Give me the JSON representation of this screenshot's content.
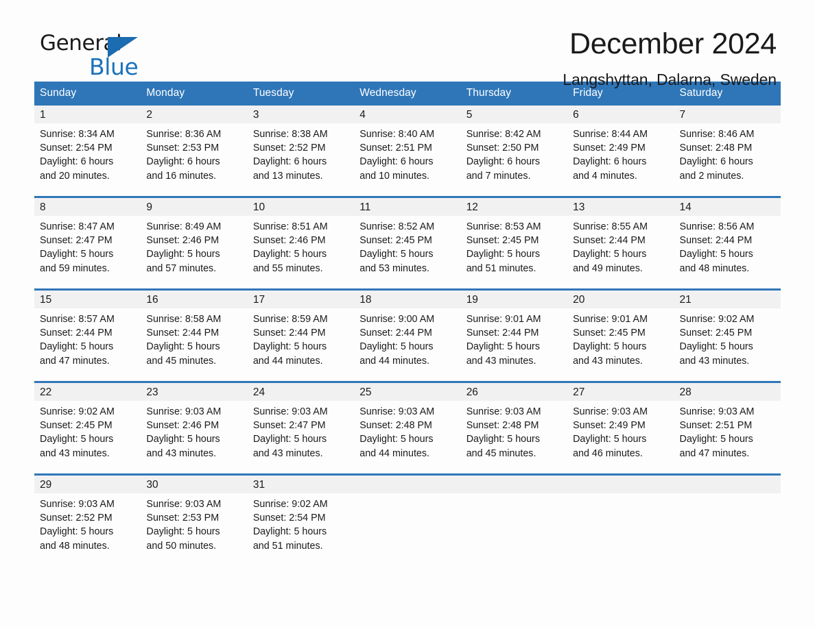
{
  "brand": {
    "name_part1": "General",
    "name_part2": "Blue",
    "accent_color": "#1b72bb",
    "header_color": "#2f76b8"
  },
  "header": {
    "title": "December 2024",
    "location": "Langshyttan, Dalarna, Sweden"
  },
  "calendar": {
    "weekday_headers": [
      "Sunday",
      "Monday",
      "Tuesday",
      "Wednesday",
      "Thursday",
      "Friday",
      "Saturday"
    ],
    "weeks": [
      [
        {
          "day": "1",
          "sunrise": "Sunrise: 8:34 AM",
          "sunset": "Sunset: 2:54 PM",
          "daylight_line1": "Daylight: 6 hours",
          "daylight_line2": "and 20 minutes."
        },
        {
          "day": "2",
          "sunrise": "Sunrise: 8:36 AM",
          "sunset": "Sunset: 2:53 PM",
          "daylight_line1": "Daylight: 6 hours",
          "daylight_line2": "and 16 minutes."
        },
        {
          "day": "3",
          "sunrise": "Sunrise: 8:38 AM",
          "sunset": "Sunset: 2:52 PM",
          "daylight_line1": "Daylight: 6 hours",
          "daylight_line2": "and 13 minutes."
        },
        {
          "day": "4",
          "sunrise": "Sunrise: 8:40 AM",
          "sunset": "Sunset: 2:51 PM",
          "daylight_line1": "Daylight: 6 hours",
          "daylight_line2": "and 10 minutes."
        },
        {
          "day": "5",
          "sunrise": "Sunrise: 8:42 AM",
          "sunset": "Sunset: 2:50 PM",
          "daylight_line1": "Daylight: 6 hours",
          "daylight_line2": "and 7 minutes."
        },
        {
          "day": "6",
          "sunrise": "Sunrise: 8:44 AM",
          "sunset": "Sunset: 2:49 PM",
          "daylight_line1": "Daylight: 6 hours",
          "daylight_line2": "and 4 minutes."
        },
        {
          "day": "7",
          "sunrise": "Sunrise: 8:46 AM",
          "sunset": "Sunset: 2:48 PM",
          "daylight_line1": "Daylight: 6 hours",
          "daylight_line2": "and 2 minutes."
        }
      ],
      [
        {
          "day": "8",
          "sunrise": "Sunrise: 8:47 AM",
          "sunset": "Sunset: 2:47 PM",
          "daylight_line1": "Daylight: 5 hours",
          "daylight_line2": "and 59 minutes."
        },
        {
          "day": "9",
          "sunrise": "Sunrise: 8:49 AM",
          "sunset": "Sunset: 2:46 PM",
          "daylight_line1": "Daylight: 5 hours",
          "daylight_line2": "and 57 minutes."
        },
        {
          "day": "10",
          "sunrise": "Sunrise: 8:51 AM",
          "sunset": "Sunset: 2:46 PM",
          "daylight_line1": "Daylight: 5 hours",
          "daylight_line2": "and 55 minutes."
        },
        {
          "day": "11",
          "sunrise": "Sunrise: 8:52 AM",
          "sunset": "Sunset: 2:45 PM",
          "daylight_line1": "Daylight: 5 hours",
          "daylight_line2": "and 53 minutes."
        },
        {
          "day": "12",
          "sunrise": "Sunrise: 8:53 AM",
          "sunset": "Sunset: 2:45 PM",
          "daylight_line1": "Daylight: 5 hours",
          "daylight_line2": "and 51 minutes."
        },
        {
          "day": "13",
          "sunrise": "Sunrise: 8:55 AM",
          "sunset": "Sunset: 2:44 PM",
          "daylight_line1": "Daylight: 5 hours",
          "daylight_line2": "and 49 minutes."
        },
        {
          "day": "14",
          "sunrise": "Sunrise: 8:56 AM",
          "sunset": "Sunset: 2:44 PM",
          "daylight_line1": "Daylight: 5 hours",
          "daylight_line2": "and 48 minutes."
        }
      ],
      [
        {
          "day": "15",
          "sunrise": "Sunrise: 8:57 AM",
          "sunset": "Sunset: 2:44 PM",
          "daylight_line1": "Daylight: 5 hours",
          "daylight_line2": "and 47 minutes."
        },
        {
          "day": "16",
          "sunrise": "Sunrise: 8:58 AM",
          "sunset": "Sunset: 2:44 PM",
          "daylight_line1": "Daylight: 5 hours",
          "daylight_line2": "and 45 minutes."
        },
        {
          "day": "17",
          "sunrise": "Sunrise: 8:59 AM",
          "sunset": "Sunset: 2:44 PM",
          "daylight_line1": "Daylight: 5 hours",
          "daylight_line2": "and 44 minutes."
        },
        {
          "day": "18",
          "sunrise": "Sunrise: 9:00 AM",
          "sunset": "Sunset: 2:44 PM",
          "daylight_line1": "Daylight: 5 hours",
          "daylight_line2": "and 44 minutes."
        },
        {
          "day": "19",
          "sunrise": "Sunrise: 9:01 AM",
          "sunset": "Sunset: 2:44 PM",
          "daylight_line1": "Daylight: 5 hours",
          "daylight_line2": "and 43 minutes."
        },
        {
          "day": "20",
          "sunrise": "Sunrise: 9:01 AM",
          "sunset": "Sunset: 2:45 PM",
          "daylight_line1": "Daylight: 5 hours",
          "daylight_line2": "and 43 minutes."
        },
        {
          "day": "21",
          "sunrise": "Sunrise: 9:02 AM",
          "sunset": "Sunset: 2:45 PM",
          "daylight_line1": "Daylight: 5 hours",
          "daylight_line2": "and 43 minutes."
        }
      ],
      [
        {
          "day": "22",
          "sunrise": "Sunrise: 9:02 AM",
          "sunset": "Sunset: 2:45 PM",
          "daylight_line1": "Daylight: 5 hours",
          "daylight_line2": "and 43 minutes."
        },
        {
          "day": "23",
          "sunrise": "Sunrise: 9:03 AM",
          "sunset": "Sunset: 2:46 PM",
          "daylight_line1": "Daylight: 5 hours",
          "daylight_line2": "and 43 minutes."
        },
        {
          "day": "24",
          "sunrise": "Sunrise: 9:03 AM",
          "sunset": "Sunset: 2:47 PM",
          "daylight_line1": "Daylight: 5 hours",
          "daylight_line2": "and 43 minutes."
        },
        {
          "day": "25",
          "sunrise": "Sunrise: 9:03 AM",
          "sunset": "Sunset: 2:48 PM",
          "daylight_line1": "Daylight: 5 hours",
          "daylight_line2": "and 44 minutes."
        },
        {
          "day": "26",
          "sunrise": "Sunrise: 9:03 AM",
          "sunset": "Sunset: 2:48 PM",
          "daylight_line1": "Daylight: 5 hours",
          "daylight_line2": "and 45 minutes."
        },
        {
          "day": "27",
          "sunrise": "Sunrise: 9:03 AM",
          "sunset": "Sunset: 2:49 PM",
          "daylight_line1": "Daylight: 5 hours",
          "daylight_line2": "and 46 minutes."
        },
        {
          "day": "28",
          "sunrise": "Sunrise: 9:03 AM",
          "sunset": "Sunset: 2:51 PM",
          "daylight_line1": "Daylight: 5 hours",
          "daylight_line2": "and 47 minutes."
        }
      ],
      [
        {
          "day": "29",
          "sunrise": "Sunrise: 9:03 AM",
          "sunset": "Sunset: 2:52 PM",
          "daylight_line1": "Daylight: 5 hours",
          "daylight_line2": "and 48 minutes."
        },
        {
          "day": "30",
          "sunrise": "Sunrise: 9:03 AM",
          "sunset": "Sunset: 2:53 PM",
          "daylight_line1": "Daylight: 5 hours",
          "daylight_line2": "and 50 minutes."
        },
        {
          "day": "31",
          "sunrise": "Sunrise: 9:02 AM",
          "sunset": "Sunset: 2:54 PM",
          "daylight_line1": "Daylight: 5 hours",
          "daylight_line2": "and 51 minutes."
        },
        {
          "day": "",
          "sunrise": "",
          "sunset": "",
          "daylight_line1": "",
          "daylight_line2": ""
        },
        {
          "day": "",
          "sunrise": "",
          "sunset": "",
          "daylight_line1": "",
          "daylight_line2": ""
        },
        {
          "day": "",
          "sunrise": "",
          "sunset": "",
          "daylight_line1": "",
          "daylight_line2": ""
        },
        {
          "day": "",
          "sunrise": "",
          "sunset": "",
          "daylight_line1": "",
          "daylight_line2": ""
        }
      ]
    ]
  }
}
